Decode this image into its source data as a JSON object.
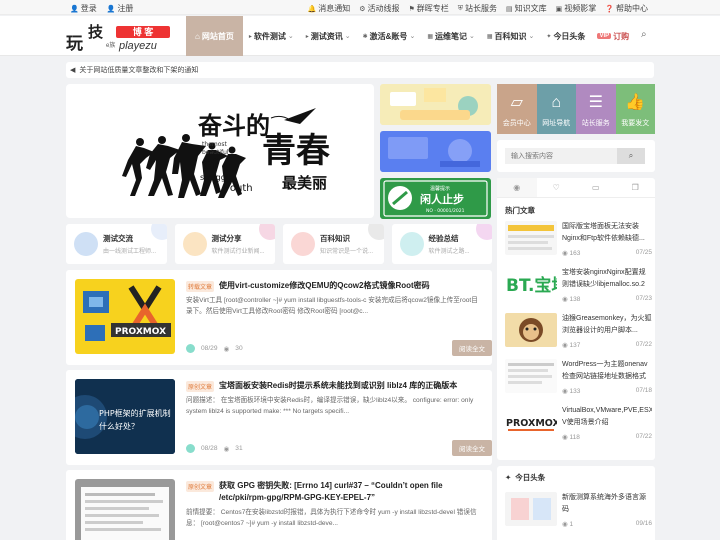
{
  "topbar": {
    "left": [
      {
        "icon": "user-icon",
        "label": "登录"
      },
      {
        "icon": "user-plus-icon",
        "label": "注册"
      }
    ],
    "right": [
      {
        "icon": "bell-icon",
        "label": "消息通知"
      },
      {
        "icon": "gift-icon",
        "label": "活动线报"
      },
      {
        "icon": "group-icon",
        "label": "群晖专栏"
      },
      {
        "icon": "shield-icon",
        "label": "站长服务"
      },
      {
        "icon": "book-icon",
        "label": "知识文库"
      },
      {
        "icon": "video-icon",
        "label": "视频影掌"
      },
      {
        "icon": "help-icon",
        "label": "帮助中心"
      }
    ]
  },
  "logo": {
    "main1": "玩",
    "main2": "技",
    "badge": "博 客",
    "site": "playezu",
    "tiny": "e族"
  },
  "nav": {
    "items": [
      {
        "label": "网站首页",
        "active": true
      },
      {
        "label": "软件测试"
      },
      {
        "label": "测试资讯"
      },
      {
        "label": "激活&账号"
      },
      {
        "label": "运维笔记"
      },
      {
        "label": "百科知识"
      },
      {
        "label": "今日头条"
      },
      {
        "label": "订购",
        "badge": "VIP"
      }
    ]
  },
  "notice": {
    "text": "关于网站低质量文章整改和下架的通知"
  },
  "banner": {
    "line1": "奋斗的",
    "line2": "青春",
    "line3": "最美丽",
    "en1": "themost",
    "en2": "beautiful",
    "en3": "of",
    "en4": "struggle",
    "en5": "youth"
  },
  "thumb3": {
    "title": "闲人止步",
    "sub": "温馨提示",
    "code": "NO · 00001/2021"
  },
  "side_icons": [
    {
      "label": "会员中心",
      "color": "#c9a48a"
    },
    {
      "label": "网址导航",
      "color": "#6d9fa8"
    },
    {
      "label": "站长服务",
      "color": "#b08ac0"
    },
    {
      "label": "我要发文",
      "color": "#7dbe7a"
    }
  ],
  "search": {
    "placeholder": "输入搜索内容"
  },
  "cats": [
    {
      "title": "测试交流",
      "desc": "由一线测试工程师...",
      "color": "#cfe0f5"
    },
    {
      "title": "测试分享",
      "desc": "软件测试行业新闻...",
      "color": "#fbe4c2"
    },
    {
      "title": "百科知识",
      "desc": "知识常识是一个说...",
      "color": "#fad7d5"
    },
    {
      "title": "经验总结",
      "desc": "软件测试之路...",
      "color": "#cfeff0"
    }
  ],
  "posts": [
    {
      "tag": "转载文章",
      "title": "使用virt-customize修改QEMU的Qcow2格式镜像Root密码",
      "excerpt": "安装Virt工具 [root@controller ~]# yum install libguestfs-tools-c 安装完成后将qcow2镜像上传至root目录下。然后使用Virt工具修改Root密码 修改Root密码 [root@c...",
      "date": "08/29",
      "views": "30",
      "read": "阅读全文"
    },
    {
      "tag": "原创文章",
      "title": "宝塔面板安装Redis时提示系统未能找到或识别 liblz4 库的正确版本",
      "excerpt": "问题描述： 在宝塔面板环境中安装Redis时，编译提示错误，缺少liblz4以来。 configure: error: only system liblz4 is supported make: *** No targets specifi...",
      "date": "08/28",
      "views": "31",
      "read": "阅读全文",
      "thumb_text": "PHP框架的扩展机制什么好处？"
    },
    {
      "tag": "原创文章",
      "title": "获取 GPG 密钥失败: [Errno 14] curl#37 – “Couldn’t open file /etc/pki/rpm-gpg/RPM-GPG-KEY-EPEL-7”",
      "excerpt": "前情提要： Centos7在安装libzstd时报错，具体为执行下述命令时 yum -y install libzstd-devel 错误信息： [root@centos7 ~]# yum -y install libzstd-deve..."
    }
  ],
  "hot": {
    "heading": "热门文章",
    "items": [
      {
        "title": "国际版宝塔面板无法安装Nginx和Ftp软件依赖缺德...",
        "views": "163",
        "date": "07/25"
      },
      {
        "title": "宝塔安装nginxNginx配置规则错误缺少libjemalloc.so.2",
        "views": "138",
        "date": "07/23",
        "img_text": "BT.宝塔"
      },
      {
        "title": "油猴Greasemonkey，为火狐浏览器设计的用户脚本...",
        "views": "137",
        "date": "07/22"
      },
      {
        "title": "WordPress一为主题onenav检查网站链接地址数据格式",
        "views": "133",
        "date": "07/18"
      },
      {
        "title": "VirtualBox,VMware,PVE,ESXi,Hyper-V使用场景介绍",
        "views": "118",
        "date": "07/22",
        "img_text": "PROXMOX"
      }
    ]
  },
  "toutiao": {
    "heading": "今日头条",
    "items": [
      {
        "title": "新版测算系统海外多语言源码",
        "views": "1",
        "date": "09/16"
      }
    ]
  }
}
